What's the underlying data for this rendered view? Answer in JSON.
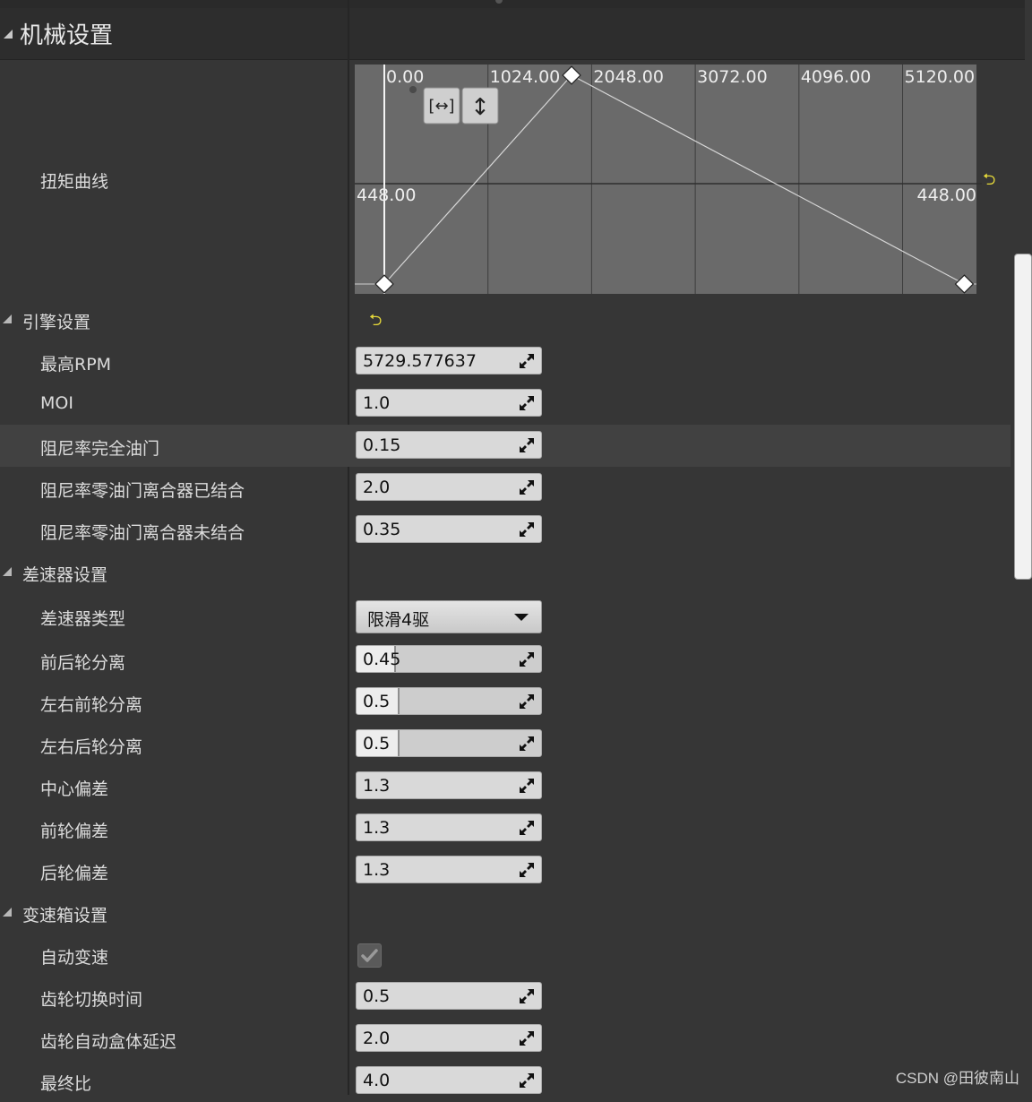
{
  "panel": {
    "title": "机械设置",
    "reset_glyph": "⮌"
  },
  "torque": {
    "label": "扭矩曲线",
    "fit_horizontal_label": "[↔]",
    "fit_vertical_label": "↕"
  },
  "chart_data": {
    "type": "line",
    "title": "",
    "xlabel": "",
    "ylabel": "",
    "x_ticks": [
      "0.00",
      "1024.00",
      "2048.00",
      "3072.00",
      "4096.00",
      "5120.00"
    ],
    "y_tick_left": "448.00",
    "y_tick_right": "448.00",
    "xlim": [
      0,
      5850
    ],
    "ylim": [
      0,
      665
    ],
    "series": [
      {
        "x": [
          0,
          1850,
          5730
        ],
        "y": [
          0,
          665,
          0
        ]
      }
    ]
  },
  "engine": {
    "label": "引擎设置",
    "rows": [
      {
        "label": "最高RPM",
        "value": "5729.577637"
      },
      {
        "label": "MOI",
        "value": "1.0"
      },
      {
        "label": "阻尼率完全油门",
        "value": "0.15"
      },
      {
        "label": "阻尼率零油门离合器已结合",
        "value": "2.0"
      },
      {
        "label": "阻尼率零油门离合器未结合",
        "value": "0.35"
      }
    ]
  },
  "differential": {
    "label": "差速器设置",
    "type_label": "差速器类型",
    "type_value": "限滑4驱",
    "rows": [
      {
        "label": "前后轮分离",
        "value": "0.45",
        "level": 0.45
      },
      {
        "label": "左右前轮分离",
        "value": "0.5",
        "level": 0.5
      },
      {
        "label": "左右后轮分离",
        "value": "0.5",
        "level": 0.5
      },
      {
        "label": "中心偏差",
        "value": "1.3"
      },
      {
        "label": "前轮偏差",
        "value": "1.3"
      },
      {
        "label": "后轮偏差",
        "value": "1.3"
      }
    ]
  },
  "transmission": {
    "label": "变速箱设置",
    "auto_label": "自动变速",
    "auto_checked": true,
    "rows": [
      {
        "label": "齿轮切换时间",
        "value": "0.5"
      },
      {
        "label": "齿轮自动盒体延迟",
        "value": "2.0"
      },
      {
        "label": "最终比",
        "value": "4.0"
      }
    ]
  },
  "watermark": "CSDN @田彼南山"
}
